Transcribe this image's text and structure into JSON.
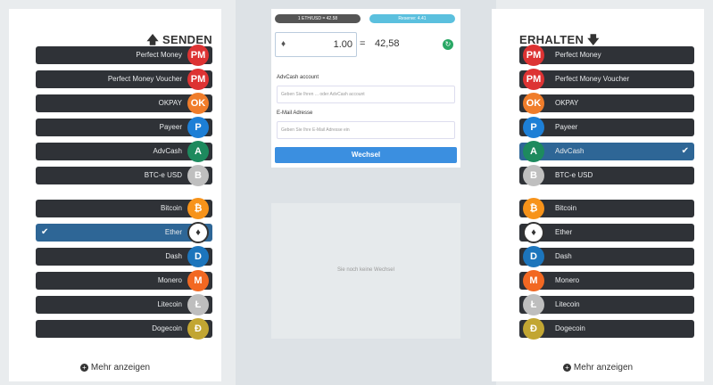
{
  "send": {
    "title": "SENDEN",
    "items": [
      {
        "label": "Perfect Money",
        "icon": "PM",
        "color": "#dd3333",
        "active": false
      },
      {
        "label": "Perfect Money Voucher",
        "icon": "PM",
        "color": "#dd3333",
        "active": false
      },
      {
        "label": "OKPAY",
        "icon": "OK",
        "color": "#f07d2b",
        "active": false
      },
      {
        "label": "Payeer",
        "icon": "P",
        "color": "#1d7fd6",
        "active": false
      },
      {
        "label": "AdvCash",
        "icon": "A",
        "color": "#1d8a5e",
        "active": false
      },
      {
        "label": "BTC-e USD",
        "icon": "B",
        "color": "#bfbfbf",
        "active": false
      },
      {
        "label": "Bitcoin",
        "icon": "₿",
        "color": "#f7931a",
        "active": false
      },
      {
        "label": "Ether",
        "icon": "♦",
        "color": "#ffffff",
        "active": true
      },
      {
        "label": "Dash",
        "icon": "D",
        "color": "#1c75bc",
        "active": false
      },
      {
        "label": "Monero",
        "icon": "M",
        "color": "#f26822",
        "active": false
      },
      {
        "label": "Litecoin",
        "icon": "Ł",
        "color": "#bebebe",
        "active": false
      },
      {
        "label": "Dogecoin",
        "icon": "Ð",
        "color": "#c2a633",
        "active": false
      }
    ],
    "more": "Mehr anzeigen"
  },
  "receive": {
    "title": "ERHALTEN",
    "items": [
      {
        "label": "Perfect Money",
        "icon": "PM",
        "color": "#dd3333",
        "active": false
      },
      {
        "label": "Perfect Money Voucher",
        "icon": "PM",
        "color": "#dd3333",
        "active": false
      },
      {
        "label": "OKPAY",
        "icon": "OK",
        "color": "#f07d2b",
        "active": false
      },
      {
        "label": "Payeer",
        "icon": "P",
        "color": "#1d7fd6",
        "active": false
      },
      {
        "label": "AdvCash",
        "icon": "A",
        "color": "#1d8a5e",
        "active": true
      },
      {
        "label": "BTC-e USD",
        "icon": "B",
        "color": "#bfbfbf",
        "active": false
      },
      {
        "label": "Bitcoin",
        "icon": "₿",
        "color": "#f7931a",
        "active": false
      },
      {
        "label": "Ether",
        "icon": "♦",
        "color": "#ffffff",
        "active": false
      },
      {
        "label": "Dash",
        "icon": "D",
        "color": "#1c75bc",
        "active": false
      },
      {
        "label": "Monero",
        "icon": "M",
        "color": "#f26822",
        "active": false
      },
      {
        "label": "Litecoin",
        "icon": "Ł",
        "color": "#bebebe",
        "active": false
      },
      {
        "label": "Dogecoin",
        "icon": "Ð",
        "color": "#c2a633",
        "active": false
      }
    ],
    "more": "Mehr anzeigen"
  },
  "exchange": {
    "rate_pill": "1 ETH/USD = 42.58",
    "reserve_pill": "Reserve: 4.41",
    "amount": "1.00",
    "equals": "=",
    "result": "42,58",
    "account_label": "AdvCash account",
    "account_placeholder": "Geben Sie Ihren ... oder AdvCash account",
    "email_label": "E-Mail Adresse",
    "email_placeholder": "Geben Sie Ihre E-Mail Adresse ein",
    "submit": "Wechsel",
    "history_text": "Sie noch keine Wechsel"
  },
  "colors": {
    "button_bg": "#2f3237",
    "active_bg": "#2e6696",
    "submit_bg": "#3b8fe0",
    "center_bg": "#dde2e6"
  }
}
